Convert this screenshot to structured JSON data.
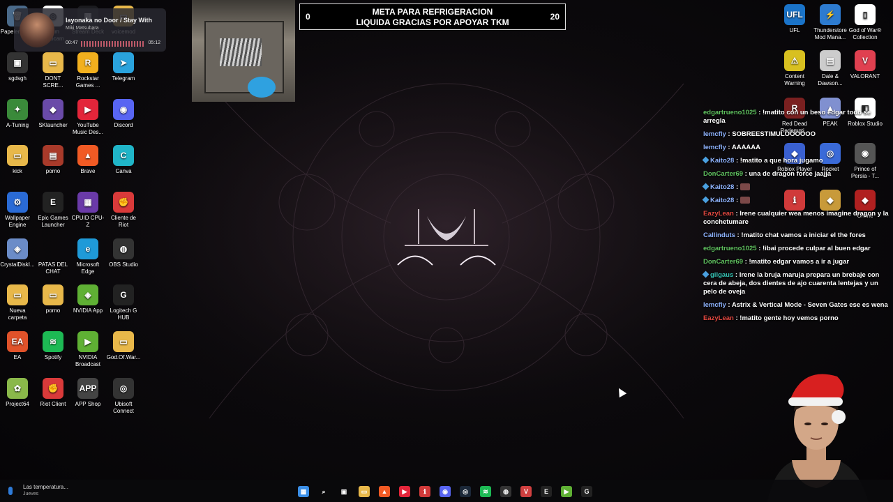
{
  "desktop_icons_left": [
    {
      "label": "Papeler recicl",
      "color": "#4a6a8a",
      "glyph": "🗑"
    },
    {
      "label": "Irium Webcam",
      "color": "#ffffff",
      "glyph": "◎"
    },
    {
      "label": "Stream Deck",
      "color": "#1b1b1f",
      "glyph": "▦"
    },
    {
      "label": "voicemod",
      "color": "#e8b84a",
      "glyph": "▭"
    },
    {
      "label": "sgdsgh",
      "color": "#333333",
      "glyph": "▣"
    },
    {
      "label": "DONT SCRE...",
      "color": "#e8b84a",
      "glyph": "▭"
    },
    {
      "label": "Rockstar Games ...",
      "color": "#f2b01e",
      "glyph": "R"
    },
    {
      "label": "Telegram",
      "color": "#2aa3dd",
      "glyph": "➤"
    },
    {
      "label": "A-Tuning",
      "color": "#3a8a3a",
      "glyph": "✦"
    },
    {
      "label": "SKlauncher",
      "color": "#6a4aa8",
      "glyph": "◆"
    },
    {
      "label": "YouTube Music Des...",
      "color": "#e3253a",
      "glyph": "▶"
    },
    {
      "label": "Discord",
      "color": "#5865f2",
      "glyph": "◉"
    },
    {
      "label": "kick",
      "color": "#e8b84a",
      "glyph": "▭"
    },
    {
      "label": "porno",
      "color": "#a83a2a",
      "glyph": "▤"
    },
    {
      "label": "Brave",
      "color": "#f15a24",
      "glyph": "▲"
    },
    {
      "label": "Canva",
      "color": "#20b5c8",
      "glyph": "C"
    },
    {
      "label": "Wallpaper Engine",
      "color": "#2a6bd6",
      "glyph": "⚙"
    },
    {
      "label": "Epic Games Launcher",
      "color": "#222222",
      "glyph": "E"
    },
    {
      "label": "CPUID CPU-Z",
      "color": "#6a3aa8",
      "glyph": "▦"
    },
    {
      "label": "Cliente de Riot",
      "color": "#d93a3a",
      "glyph": "✊"
    },
    {
      "label": "CrystalDiskI...",
      "color": "#6b8cc8",
      "glyph": "◈"
    },
    {
      "label": "PATAS DEL CHAT",
      "color": "transparent",
      "glyph": ""
    },
    {
      "label": "Microsoft Edge",
      "color": "#1f9ad8",
      "glyph": "e"
    },
    {
      "label": "OBS Studio",
      "color": "#333333",
      "glyph": "◍"
    },
    {
      "label": "Nueva carpeta",
      "color": "#e8b84a",
      "glyph": "▭"
    },
    {
      "label": "porno",
      "color": "#e8b84a",
      "glyph": "▭"
    },
    {
      "label": "NVIDIA App",
      "color": "#5fb034",
      "glyph": "◈"
    },
    {
      "label": "Logitech G HUB",
      "color": "#222222",
      "glyph": "G"
    },
    {
      "label": "EA",
      "color": "#e0522a",
      "glyph": "EA"
    },
    {
      "label": "Spotify",
      "color": "#1db954",
      "glyph": "≋"
    },
    {
      "label": "NVIDIA Broadcast",
      "color": "#5fb034",
      "glyph": "▶"
    },
    {
      "label": "God.Of.War...",
      "color": "#e8b84a",
      "glyph": "▭"
    },
    {
      "label": "Project64",
      "color": "#8ab84a",
      "glyph": "✿"
    },
    {
      "label": "Riot Client",
      "color": "#d93a3a",
      "glyph": "✊"
    },
    {
      "label": "APP Shop",
      "color": "#444444",
      "glyph": "APP"
    },
    {
      "label": "Ubisoft Connect",
      "color": "#333333",
      "glyph": "◎"
    }
  ],
  "desktop_icons_right": [
    {
      "label": "UFL",
      "color": "#1a73c8",
      "glyph": "UFL"
    },
    {
      "label": "Thunderstore Mod Mana...",
      "color": "#2d7bd0",
      "glyph": "⚡"
    },
    {
      "label": "God of War® Collection",
      "color": "#ffffff",
      "glyph": "▯"
    },
    {
      "label": "Content Warning",
      "color": "#d8c020",
      "glyph": "⚠"
    },
    {
      "label": "Dale & Dawson...",
      "color": "#cccccc",
      "glyph": "▤"
    },
    {
      "label": "VALORANT",
      "color": "#e04050",
      "glyph": "V"
    },
    {
      "label": "Red Dead Redempti...",
      "color": "#7a2020",
      "glyph": "R"
    },
    {
      "label": "PEAK",
      "color": "#8090d0",
      "glyph": "▲"
    },
    {
      "label": "Roblox Studio",
      "color": "#ffffff",
      "glyph": "◧"
    },
    {
      "label": "Roblox Player",
      "color": "#3a60d0",
      "glyph": "◆"
    },
    {
      "label": "Rocket",
      "color": "#3a6ad8",
      "glyph": "◎"
    },
    {
      "label": "Prince of Persia - T...",
      "color": "#555555",
      "glyph": "◉"
    },
    {
      "label": "",
      "color": "#d03a3a",
      "glyph": "ℹ"
    },
    {
      "label": "",
      "color": "#c89a3a",
      "glyph": "◆"
    },
    {
      "label": "Online",
      "color": "#b02020",
      "glyph": "◆"
    }
  ],
  "music_widget": {
    "title": "Iayonaka no Door / Stay With",
    "artist": "Miki Matsubara",
    "time_current": "00:47",
    "time_total": "05:12"
  },
  "goal": {
    "current": "0",
    "target": "20",
    "line1": "META PARA REFRIGERACION",
    "line2": "LIQUIDA GRACIAS POR APOYAR TKM"
  },
  "chat": [
    {
      "user": "edgartrueno1025",
      "color": "green",
      "text": "!matito con un beso edgar todo se arregla"
    },
    {
      "user": "lemcfly",
      "color": "blue",
      "text": "SOBREESTIMULOOOOOO"
    },
    {
      "user": "lemcfly",
      "color": "blue",
      "text": "AAAAAA"
    },
    {
      "user": "Kaito28",
      "color": "blue",
      "badge": true,
      "text": "!matito a que hora jugamo"
    },
    {
      "user": "DonCarter69",
      "color": "green",
      "text": "una de dragon force jaajja"
    },
    {
      "user": "Kaito28",
      "color": "blue",
      "badge": true,
      "emote": true,
      "text": ""
    },
    {
      "user": "Kaito28",
      "color": "blue",
      "badge": true,
      "emote": true,
      "text": ""
    },
    {
      "user": "EazyLean",
      "color": "red",
      "text": "Irene cualquier wea menos imagine dragon y la conchetumare"
    },
    {
      "user": "Callinduts",
      "color": "blue",
      "text": "!matito chat vamos a iniciar el the fores"
    },
    {
      "user": "edgartrueno1025",
      "color": "green",
      "text": "!ibai procede culpar al buen edgar"
    },
    {
      "user": "DonCarter69",
      "color": "green",
      "text": "!matito edgar vamos a ir a jugar"
    },
    {
      "user": "gilgaus",
      "color": "teal",
      "badge": true,
      "text": "Irene la bruja maruja prepara un brebaje con cera de abeja, dos dientes de ajo cuarenta lentejas y un pelo de oveja"
    },
    {
      "user": "lemcfly",
      "color": "blue",
      "text": "Astrix & Vertical Mode - Seven Gates ese es wena"
    },
    {
      "user": "EazyLean",
      "color": "red",
      "text": "!matito gente hoy vemos porno"
    }
  ],
  "taskbar": {
    "weather_line1": "Las temperatura...",
    "weather_line2": "Jueves",
    "icons": [
      {
        "name": "windows-start-icon",
        "color": "#3a8ee6",
        "glyph": "▦"
      },
      {
        "name": "search-icon",
        "color": "transparent",
        "glyph": "⌕"
      },
      {
        "name": "task-view-icon",
        "color": "transparent",
        "glyph": "▣"
      },
      {
        "name": "file-explorer-icon",
        "color": "#e8b84a",
        "glyph": "▭"
      },
      {
        "name": "brave-icon",
        "color": "#f15a24",
        "glyph": "▲"
      },
      {
        "name": "youtube-music-icon",
        "color": "#e3253a",
        "glyph": "▶"
      },
      {
        "name": "app-red-icon",
        "color": "#d03a3a",
        "glyph": "ℹ"
      },
      {
        "name": "discord-icon",
        "color": "#5865f2",
        "glyph": "◉"
      },
      {
        "name": "steam-icon",
        "color": "#1b2838",
        "glyph": "◎"
      },
      {
        "name": "spotify-icon",
        "color": "#1db954",
        "glyph": "≋"
      },
      {
        "name": "obs-icon",
        "color": "#333333",
        "glyph": "◍"
      },
      {
        "name": "valorant-icon",
        "color": "#d04040",
        "glyph": "V"
      },
      {
        "name": "epic-games-icon",
        "color": "#222222",
        "glyph": "E"
      },
      {
        "name": "nvidia-icon",
        "color": "#5fb034",
        "glyph": "▶"
      },
      {
        "name": "logitech-icon",
        "color": "#222222",
        "glyph": "G"
      }
    ]
  }
}
